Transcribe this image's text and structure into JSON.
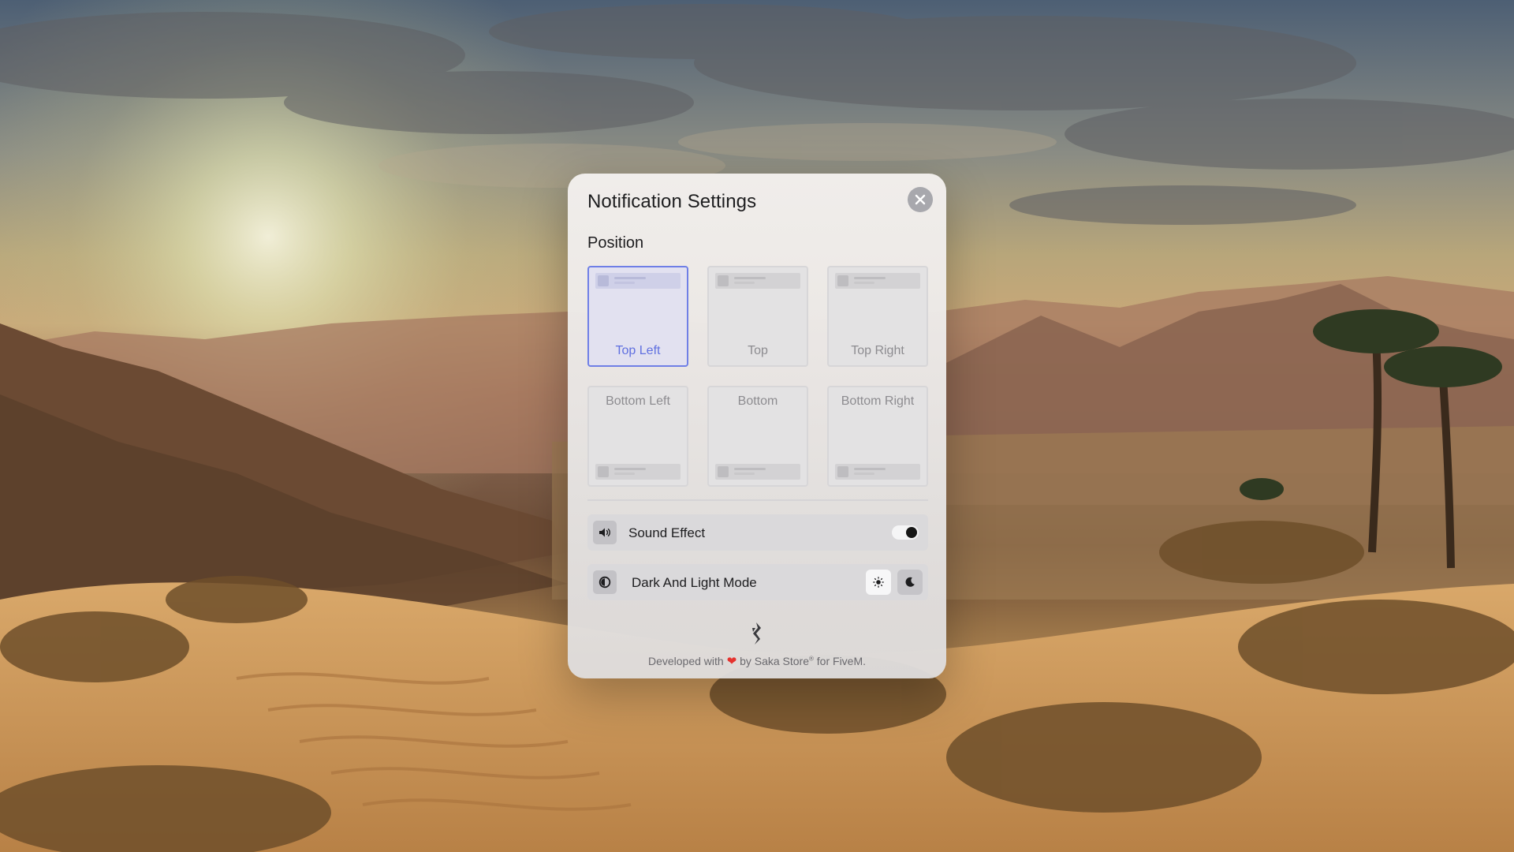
{
  "panel": {
    "title": "Notification Settings",
    "close_icon": "close-icon"
  },
  "position": {
    "label": "Position",
    "selected": "Top Left",
    "options": [
      {
        "label": "Top Left",
        "selected": true
      },
      {
        "label": "Top",
        "selected": false
      },
      {
        "label": "Top Right",
        "selected": false
      },
      {
        "label": "Bottom Left",
        "selected": false
      },
      {
        "label": "Bottom",
        "selected": false
      },
      {
        "label": "Bottom Right",
        "selected": false
      }
    ]
  },
  "sound": {
    "label": "Sound Effect",
    "icon": "speaker-icon",
    "enabled": true
  },
  "mode": {
    "label": "Dark And Light Mode",
    "icon": "contrast-icon",
    "light_icon": "sun-icon",
    "dark_icon": "moon-icon",
    "selected": "light"
  },
  "footer": {
    "prefix": "Developed with",
    "heart": "❤",
    "by": "by Saka Store",
    "registered": "®",
    "suffix": "for FiveM.",
    "logo_icon": "saka-logo-icon"
  },
  "colors": {
    "accent": "#6f7fe6",
    "heart": "#e5322e",
    "toggle_knob": "#161616"
  }
}
